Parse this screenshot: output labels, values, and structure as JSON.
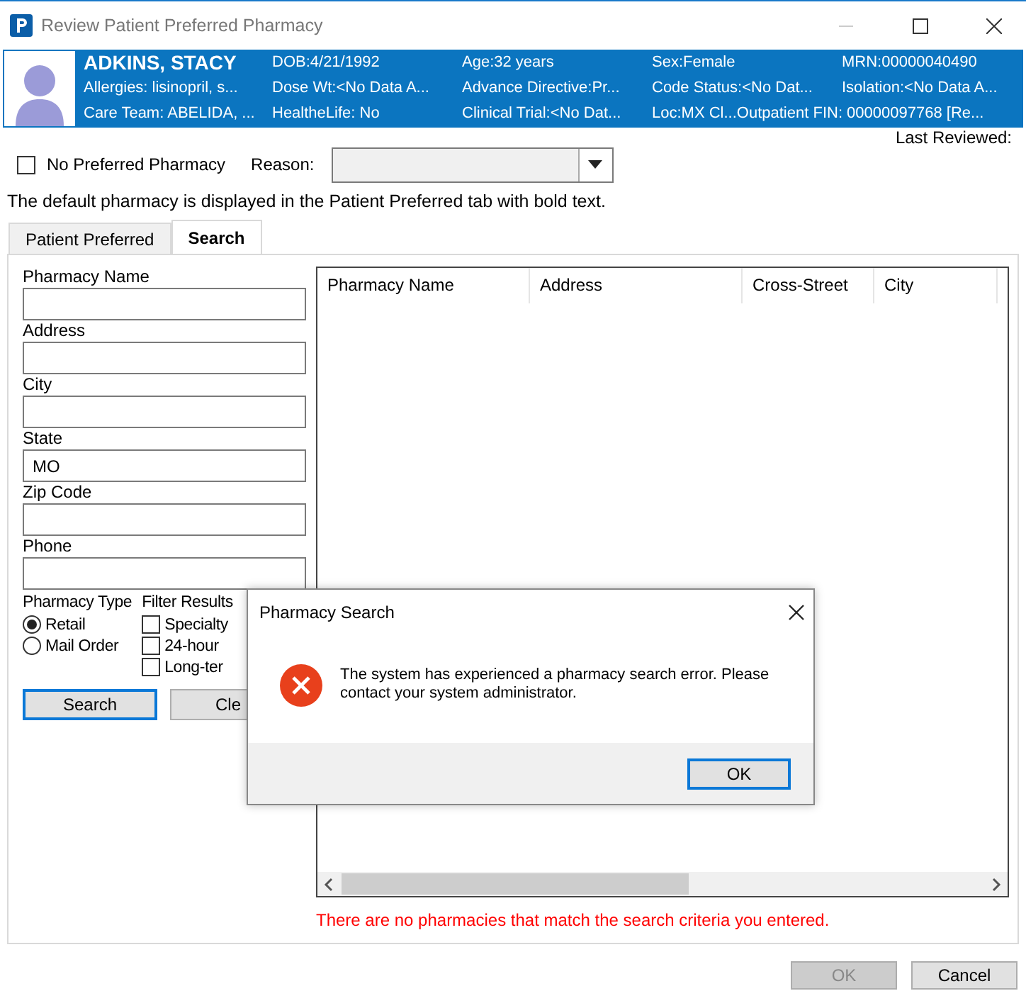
{
  "window": {
    "title": "Review Patient Preferred Pharmacy"
  },
  "banner": {
    "rows": [
      [
        "ADKINS, STACY",
        "DOB:4/21/1992",
        "Age:32 years",
        "Sex:Female",
        "MRN:00000040490"
      ],
      [
        "Allergies: lisinopril, s...",
        "Dose Wt:<No Data A...",
        "Advance Directive:Pr...",
        "Code Status:<No Dat...",
        "Isolation:<No Data A..."
      ],
      [
        "Care Team: ABELIDA, ...",
        "HealtheLife: No",
        "Clinical Trial:<No Dat...",
        "Loc:MX Cl...",
        "Outpatient FIN: 00000097768 [Re..."
      ]
    ]
  },
  "no_preferred": {
    "label": "No Preferred Pharmacy",
    "checked": false
  },
  "reason": {
    "label": "Reason:"
  },
  "last_reviewed": "Last Reviewed:",
  "note": "The default pharmacy is displayed in the Patient Preferred tab with bold text.",
  "tabs": [
    {
      "label": "Patient Preferred",
      "selected": false
    },
    {
      "label": "Search",
      "selected": true
    }
  ],
  "form": {
    "fields": [
      {
        "label": "Pharmacy Name"
      },
      {
        "label": "Address"
      },
      {
        "label": "City"
      },
      {
        "label": "State",
        "value": "MO"
      },
      {
        "label": "Zip Code"
      },
      {
        "label": "Phone"
      }
    ],
    "pharmacy_type": {
      "label": "Pharmacy Type",
      "options": [
        {
          "label": "Retail",
          "selected": true
        },
        {
          "label": "Mail Order",
          "selected": false
        }
      ]
    },
    "filter_results": {
      "label": "Filter Results",
      "options": [
        {
          "label": "Specialty",
          "checked": false
        },
        {
          "label": "24-hour",
          "checked": false
        },
        {
          "label": "Long-ter",
          "checked": false
        }
      ]
    },
    "buttons": [
      {
        "label": "Search",
        "default": true
      },
      {
        "label": "Cle",
        "default": false
      }
    ]
  },
  "table": {
    "columns": [
      "Pharmacy Name",
      "Address",
      "Cross-Street",
      "City"
    ]
  },
  "message": "There are no pharmacies that match the search criteria you entered.",
  "footer_buttons": [
    {
      "label": "OK",
      "disabled": true
    },
    {
      "label": "Cancel",
      "disabled": false
    }
  ],
  "dialog": {
    "title": "Pharmacy Search",
    "message": "The system has experienced a pharmacy search error. Please contact your system administrator.",
    "button": {
      "label": "OK",
      "default": true
    }
  }
}
